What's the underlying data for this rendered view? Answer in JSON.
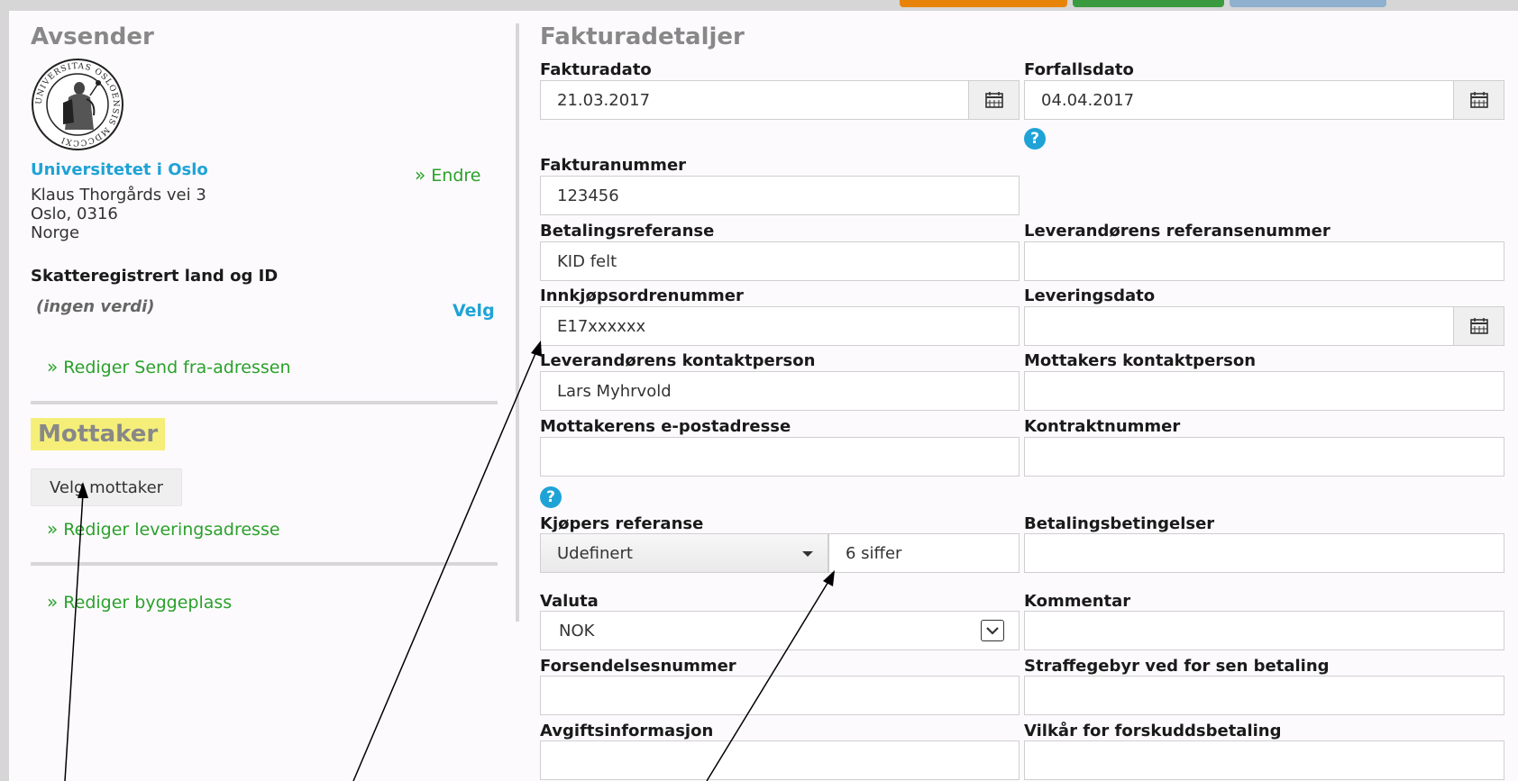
{
  "avsender": {
    "heading": "Avsender",
    "logo_text": "UNIVERSITAS OSLOENSIS MDCCCXI",
    "org_name": "Universitetet i Oslo",
    "endre_link": "Endre",
    "address_line1": "Klaus Thorgårds vei 3",
    "address_line2": "Oslo, 0316",
    "address_line3": "Norge",
    "tax_label": "Skatteregistrert land og ID",
    "tax_value": "(ingen verdi)",
    "velg_link": "Velg",
    "edit_send_from": "Rediger Send fra-adressen"
  },
  "mottaker": {
    "heading": "Mottaker",
    "velg_button": "Velg mottaker",
    "edit_delivery": "Rediger leveringsadresse",
    "edit_site": "Rediger byggeplass"
  },
  "faktura": {
    "heading": "Fakturadetaljer",
    "fakturadato_label": "Fakturadato",
    "fakturadato_value": "21.03.2017",
    "forfallsdato_label": "Forfallsdato",
    "forfallsdato_value": "04.04.2017",
    "fakturanummer_label": "Fakturanummer",
    "fakturanummer_value": "123456",
    "betalingsreferanse_label": "Betalingsreferanse",
    "betalingsreferanse_value": "KID felt",
    "lev_ref_label": "Leverandørens referansenummer",
    "lev_ref_value": "",
    "innkjop_label": "Innkjøpsordrenummer",
    "innkjop_value": "E17xxxxxx",
    "leveringsdato_label": "Leveringsdato",
    "leveringsdato_value": "",
    "lev_kontakt_label": "Leverandørens kontaktperson",
    "lev_kontakt_value": "Lars Myhrvold",
    "mott_kontakt_label": "Mottakers kontaktperson",
    "mott_kontakt_value": "",
    "mott_epost_label": "Mottakerens e-postadresse",
    "mott_epost_value": "",
    "kontrakt_label": "Kontraktnummer",
    "kontrakt_value": "",
    "kjopers_ref_label": "Kjøpers referanse",
    "kjopers_ref_select": "Udefinert",
    "kjopers_ref_value": "6 siffer",
    "betalingsbet_label": "Betalingsbetingelser",
    "betalingsbet_value": "",
    "valuta_label": "Valuta",
    "valuta_value": "NOK",
    "kommentar_label": "Kommentar",
    "kommentar_value": "",
    "forsendelse_label": "Forsendelsesnummer",
    "forsendelse_value": "",
    "straffegebyr_label": "Straffegebyr ved for sen betaling",
    "straffegebyr_value": "",
    "avgift_label": "Avgiftsinformasjon",
    "avgift_value": "",
    "vilkar_label": "Vilkår for forskuddsbetaling",
    "vilkar_value": ""
  },
  "help_icon_glyph": "?",
  "colors": {
    "link_green": "#2aa12a",
    "link_blue": "#1fa3d6",
    "highlight": "#f5ef7a",
    "toolbar_orange": "#e8840a",
    "toolbar_green": "#3a9a3f",
    "toolbar_blue": "#8fb0cf"
  }
}
